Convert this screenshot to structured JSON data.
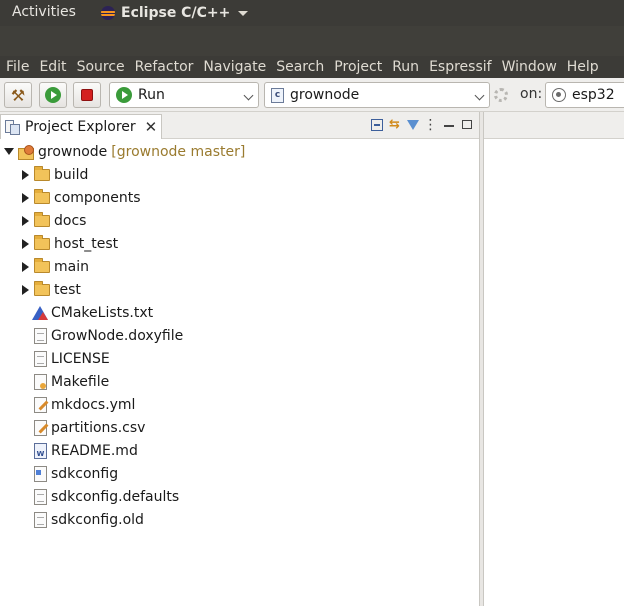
{
  "topbar": {
    "activities": "Activities",
    "app_name": "Eclipse C/C++"
  },
  "menubar": [
    "File",
    "Edit",
    "Source",
    "Refactor",
    "Navigate",
    "Search",
    "Project",
    "Run",
    "Espressif",
    "Window",
    "Help"
  ],
  "toolbar": {
    "launch_mode": "Run",
    "launch_config": "grownode",
    "on_label": "on:",
    "launch_target": "esp32"
  },
  "explorer": {
    "tab_title": "Project Explorer",
    "project": {
      "name": "grownode",
      "decoration": "[grownode master]"
    },
    "folders": [
      "build",
      "components",
      "docs",
      "host_test",
      "main",
      "test"
    ],
    "files": [
      {
        "name": "CMakeLists.txt",
        "icon": "cmake-icon"
      },
      {
        "name": "GrowNode.doxyfile",
        "icon": "file-icon"
      },
      {
        "name": "LICENSE",
        "icon": "file-icon"
      },
      {
        "name": "Makefile",
        "icon": "makefile-icon"
      },
      {
        "name": "mkdocs.yml",
        "icon": "edit-file-icon"
      },
      {
        "name": "partitions.csv",
        "icon": "edit-file-icon"
      },
      {
        "name": "README.md",
        "icon": "markdown-file-icon"
      },
      {
        "name": "sdkconfig",
        "icon": "config-file-icon"
      },
      {
        "name": "sdkconfig.defaults",
        "icon": "file-icon"
      },
      {
        "name": "sdkconfig.old",
        "icon": "file-icon"
      }
    ]
  }
}
